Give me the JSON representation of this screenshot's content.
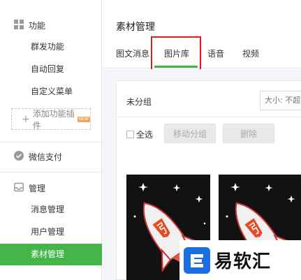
{
  "sidebar": {
    "section_function": "功能",
    "items_function": [
      "群发功能",
      "自动回复",
      "自定义菜单"
    ],
    "add_plugin": "添加功能插件",
    "new_badge": "NEW",
    "section_pay": "微信支付",
    "section_manage": "管理",
    "items_manage": [
      "消息管理",
      "用户管理",
      "素材管理"
    ],
    "active_item": "素材管理"
  },
  "main": {
    "title": "素材管理",
    "tabs": [
      "图文消息",
      "图片库",
      "语音",
      "视频"
    ],
    "active_tab": "图片库",
    "group_name": "未分组",
    "size_filter": "大小: 不超",
    "select_all": "全选",
    "move_group_button": "移动分组",
    "delete_button": "删除"
  },
  "watermark": {
    "brand": "易软汇"
  },
  "colors": {
    "accent_green": "#44b549",
    "highlight_red": "#e1191d"
  }
}
